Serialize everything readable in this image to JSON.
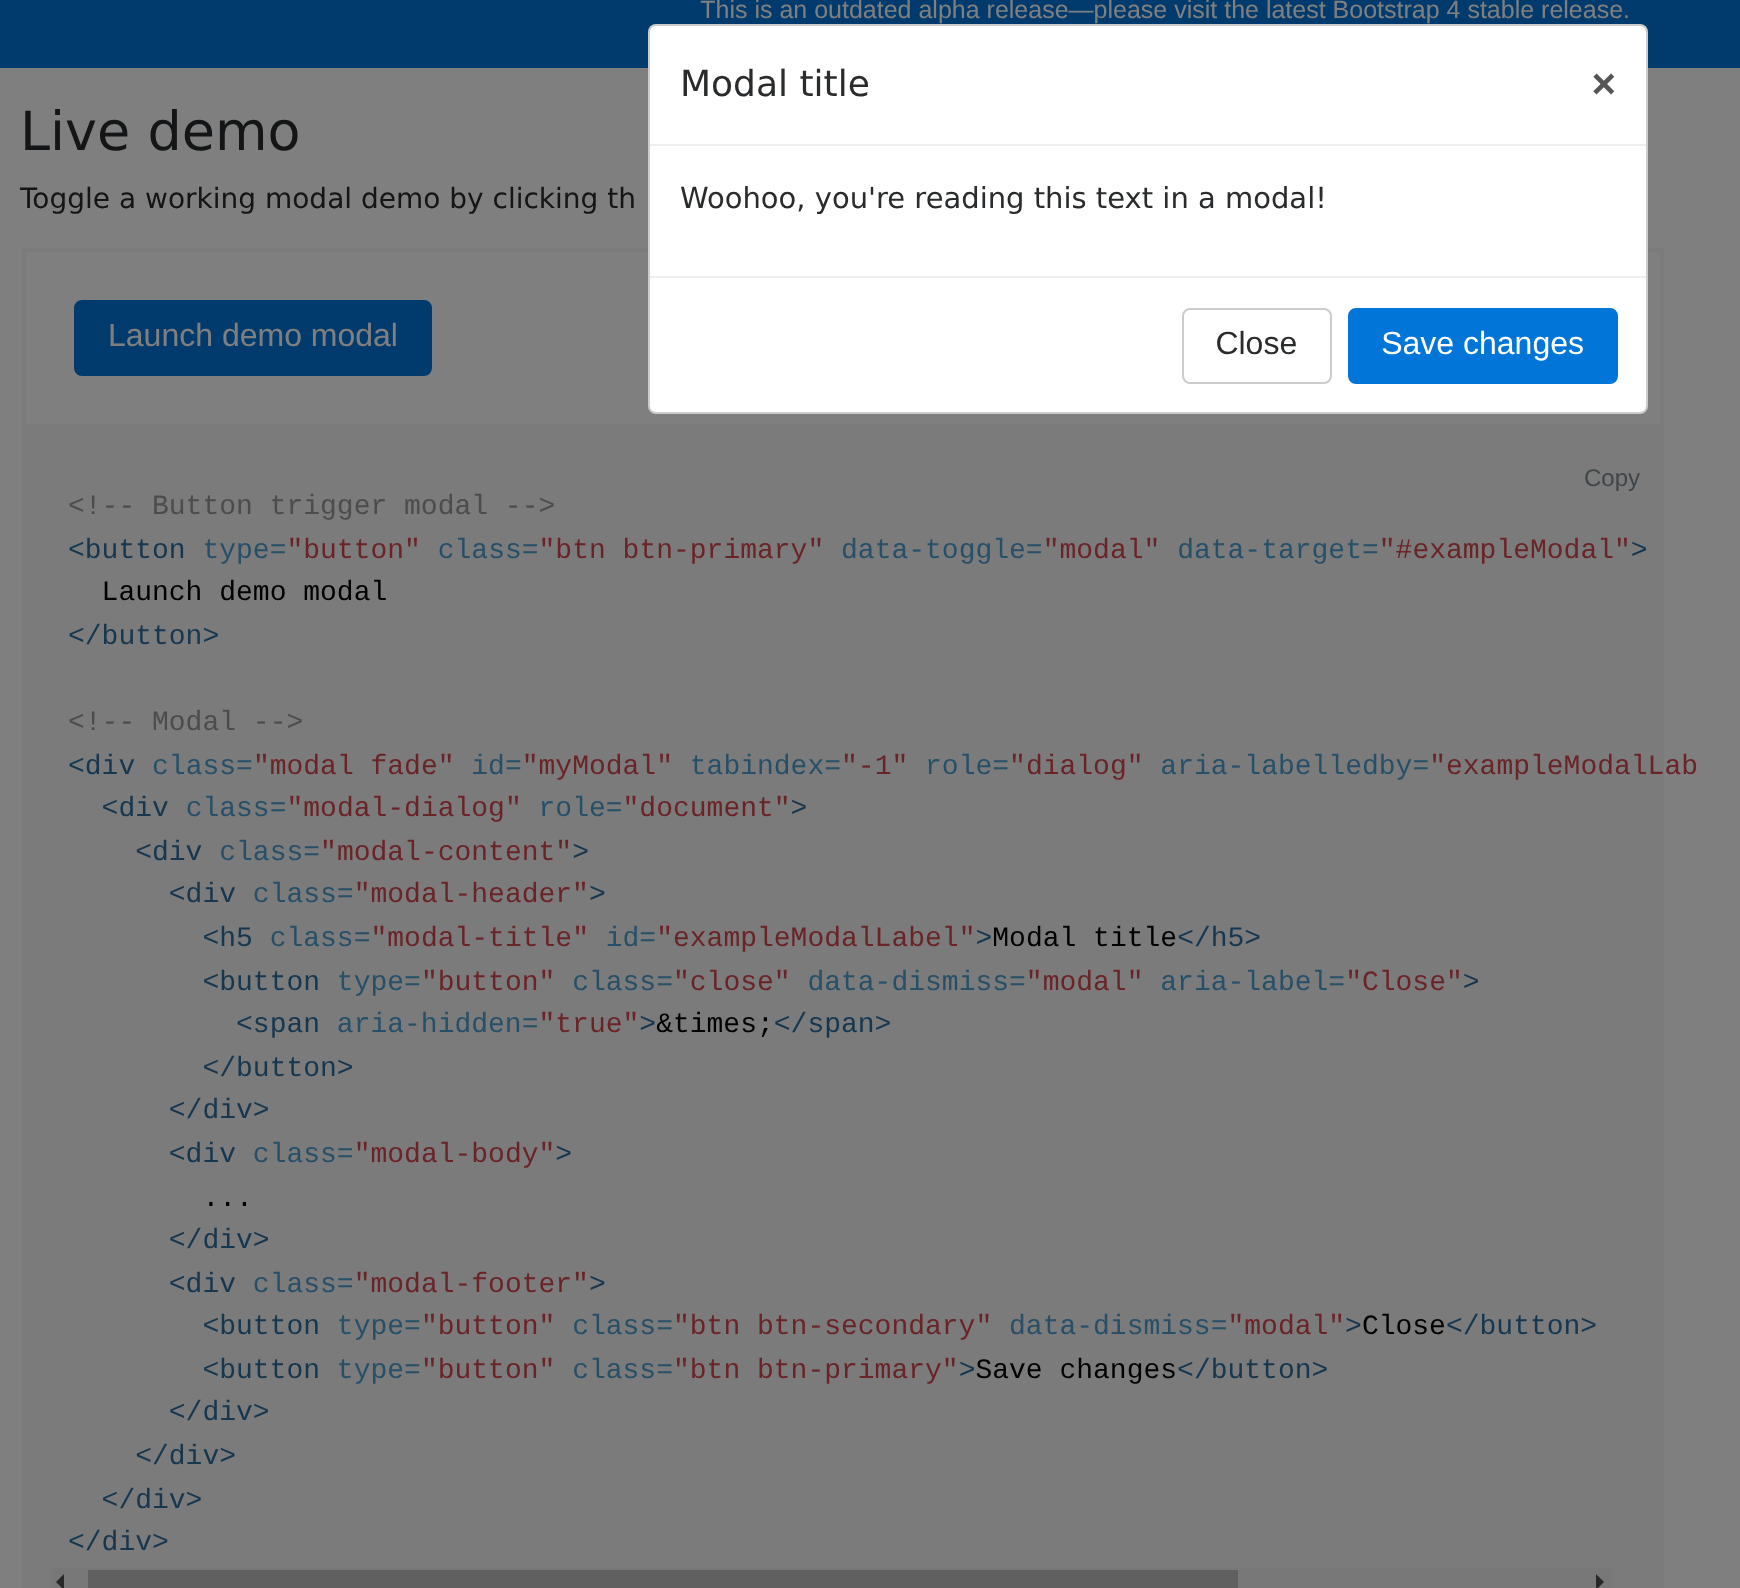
{
  "banner": {
    "text": "This is an outdated alpha release—please visit the latest Bootstrap 4 stable release."
  },
  "heading": "Live demo",
  "intro": "Toggle a working modal demo by clicking th",
  "example": {
    "button": "Launch demo modal"
  },
  "code": {
    "copy": "Copy",
    "blocks": [
      [
        [
          {
            "kind": "comment",
            "text": "<!-- Button trigger modal -->"
          }
        ],
        [
          {
            "kind": "tag",
            "text": "<button "
          },
          {
            "kind": "attr",
            "text": "type="
          },
          {
            "kind": "string",
            "text": "\"button\" "
          },
          {
            "kind": "attr",
            "text": "class="
          },
          {
            "kind": "string",
            "text": "\"btn btn-primary\" "
          },
          {
            "kind": "attr",
            "text": "data-toggle="
          },
          {
            "kind": "string",
            "text": "\"modal\" "
          },
          {
            "kind": "attr",
            "text": "data-target="
          },
          {
            "kind": "string",
            "text": "\"#exampleModal\""
          },
          {
            "kind": "tag",
            "text": ">"
          }
        ],
        [
          {
            "kind": "text",
            "text": "  Launch demo modal"
          }
        ],
        [
          {
            "kind": "tag",
            "text": "</button>"
          }
        ]
      ],
      [
        [
          {
            "kind": "comment",
            "text": "<!-- Modal -->"
          }
        ],
        [
          {
            "kind": "tag",
            "text": "<div "
          },
          {
            "kind": "attr",
            "text": "class="
          },
          {
            "kind": "string",
            "text": "\"modal fade\" "
          },
          {
            "kind": "attr",
            "text": "id="
          },
          {
            "kind": "string",
            "text": "\"myModal\" "
          },
          {
            "kind": "attr",
            "text": "tabindex="
          },
          {
            "kind": "string",
            "text": "\"-1\" "
          },
          {
            "kind": "attr",
            "text": "role="
          },
          {
            "kind": "string",
            "text": "\"dialog\" "
          },
          {
            "kind": "attr",
            "text": "aria-labelledby="
          },
          {
            "kind": "string",
            "text": "\"exampleModalLab"
          }
        ],
        [
          {
            "kind": "tag",
            "text": "  <div "
          },
          {
            "kind": "attr",
            "text": "class="
          },
          {
            "kind": "string",
            "text": "\"modal-dialog\" "
          },
          {
            "kind": "attr",
            "text": "role="
          },
          {
            "kind": "string",
            "text": "\"document\""
          },
          {
            "kind": "tag",
            "text": ">"
          }
        ],
        [
          {
            "kind": "tag",
            "text": "    <div "
          },
          {
            "kind": "attr",
            "text": "class="
          },
          {
            "kind": "string",
            "text": "\"modal-content\""
          },
          {
            "kind": "tag",
            "text": ">"
          }
        ],
        [
          {
            "kind": "tag",
            "text": "      <div "
          },
          {
            "kind": "attr",
            "text": "class="
          },
          {
            "kind": "string",
            "text": "\"modal-header\""
          },
          {
            "kind": "tag",
            "text": ">"
          }
        ],
        [
          {
            "kind": "tag",
            "text": "        <h5 "
          },
          {
            "kind": "attr",
            "text": "class="
          },
          {
            "kind": "string",
            "text": "\"modal-title\" "
          },
          {
            "kind": "attr",
            "text": "id="
          },
          {
            "kind": "string",
            "text": "\"exampleModalLabel\""
          },
          {
            "kind": "tag",
            "text": ">"
          },
          {
            "kind": "text",
            "text": "Modal title"
          },
          {
            "kind": "tag",
            "text": "</h5>"
          }
        ],
        [
          {
            "kind": "tag",
            "text": "        <button "
          },
          {
            "kind": "attr",
            "text": "type="
          },
          {
            "kind": "string",
            "text": "\"button\" "
          },
          {
            "kind": "attr",
            "text": "class="
          },
          {
            "kind": "string",
            "text": "\"close\" "
          },
          {
            "kind": "attr",
            "text": "data-dismiss="
          },
          {
            "kind": "string",
            "text": "\"modal\" "
          },
          {
            "kind": "attr",
            "text": "aria-label="
          },
          {
            "kind": "string",
            "text": "\"Close\""
          },
          {
            "kind": "tag",
            "text": ">"
          }
        ],
        [
          {
            "kind": "tag",
            "text": "          <span "
          },
          {
            "kind": "attr",
            "text": "aria-hidden="
          },
          {
            "kind": "string",
            "text": "\"true\""
          },
          {
            "kind": "tag",
            "text": ">"
          },
          {
            "kind": "text",
            "text": "&times;"
          },
          {
            "kind": "tag",
            "text": "</span>"
          }
        ],
        [
          {
            "kind": "tag",
            "text": "        </button>"
          }
        ],
        [
          {
            "kind": "tag",
            "text": "      </div>"
          }
        ],
        [
          {
            "kind": "tag",
            "text": "      <div "
          },
          {
            "kind": "attr",
            "text": "class="
          },
          {
            "kind": "string",
            "text": "\"modal-body\""
          },
          {
            "kind": "tag",
            "text": ">"
          }
        ],
        [
          {
            "kind": "text",
            "text": "        ..."
          }
        ],
        [
          {
            "kind": "tag",
            "text": "      </div>"
          }
        ],
        [
          {
            "kind": "tag",
            "text": "      <div "
          },
          {
            "kind": "attr",
            "text": "class="
          },
          {
            "kind": "string",
            "text": "\"modal-footer\""
          },
          {
            "kind": "tag",
            "text": ">"
          }
        ],
        [
          {
            "kind": "tag",
            "text": "        <button "
          },
          {
            "kind": "attr",
            "text": "type="
          },
          {
            "kind": "string",
            "text": "\"button\" "
          },
          {
            "kind": "attr",
            "text": "class="
          },
          {
            "kind": "string",
            "text": "\"btn btn-secondary\" "
          },
          {
            "kind": "attr",
            "text": "data-dismiss="
          },
          {
            "kind": "string",
            "text": "\"modal\""
          },
          {
            "kind": "tag",
            "text": ">"
          },
          {
            "kind": "text",
            "text": "Close"
          },
          {
            "kind": "tag",
            "text": "</button>"
          }
        ],
        [
          {
            "kind": "tag",
            "text": "        <button "
          },
          {
            "kind": "attr",
            "text": "type="
          },
          {
            "kind": "string",
            "text": "\"button\" "
          },
          {
            "kind": "attr",
            "text": "class="
          },
          {
            "kind": "string",
            "text": "\"btn btn-primary\""
          },
          {
            "kind": "tag",
            "text": ">"
          },
          {
            "kind": "text",
            "text": "Save changes"
          },
          {
            "kind": "tag",
            "text": "</button>"
          }
        ],
        [
          {
            "kind": "tag",
            "text": "      </div>"
          }
        ],
        [
          {
            "kind": "tag",
            "text": "    </div>"
          }
        ],
        [
          {
            "kind": "tag",
            "text": "  </div>"
          }
        ],
        [
          {
            "kind": "tag",
            "text": "</div>"
          }
        ]
      ]
    ]
  },
  "modal": {
    "title": "Modal title",
    "close": "×",
    "body": "Woohoo, you're reading this text in a modal!",
    "buttons": [
      {
        "label": "Close",
        "kind": "secondary"
      },
      {
        "label": "Save changes",
        "kind": "primary"
      }
    ]
  }
}
